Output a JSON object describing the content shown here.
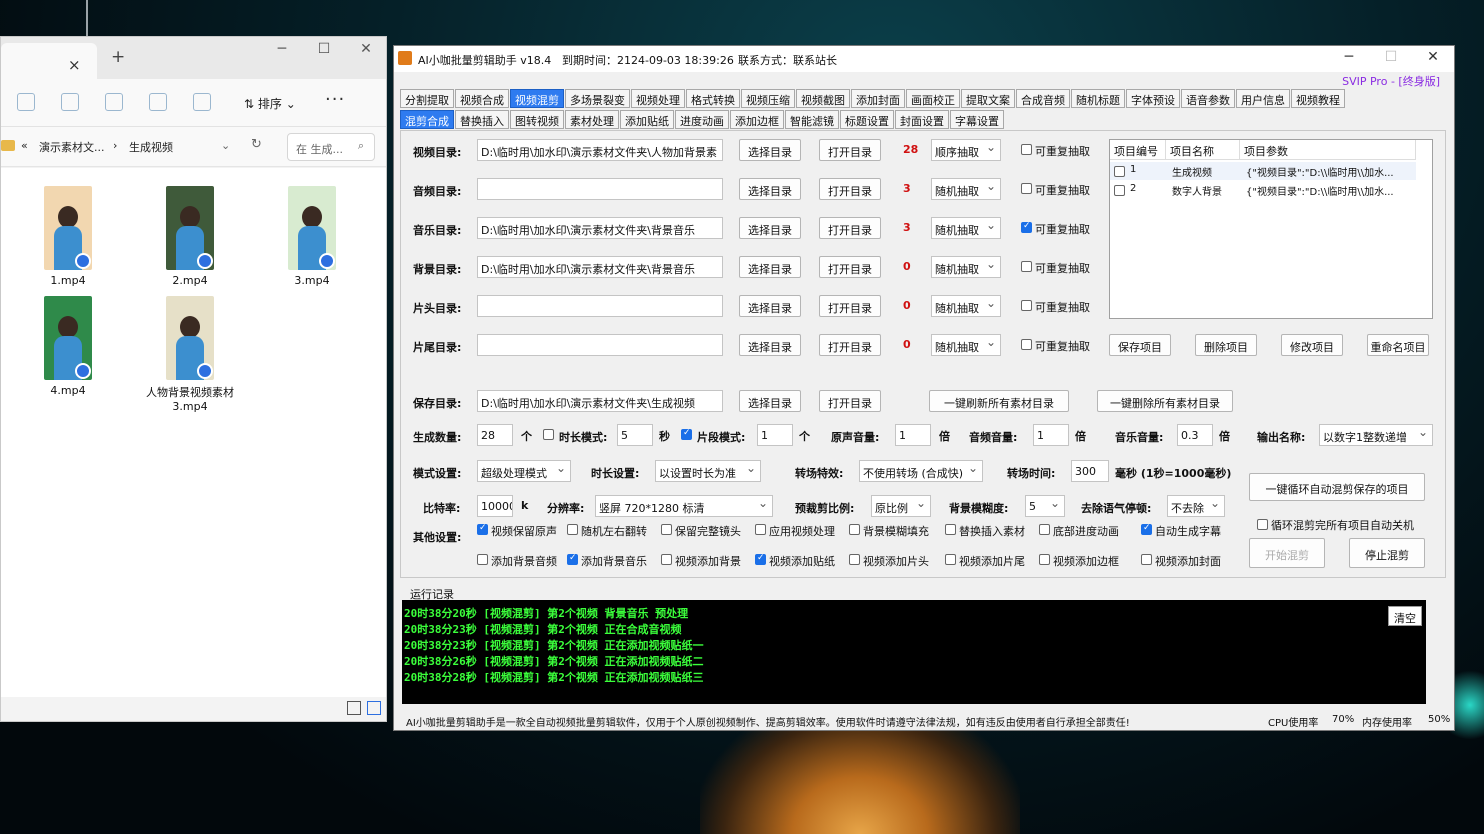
{
  "explorer": {
    "tab_close": "×",
    "new_tab": "+",
    "sort_label": "排序",
    "more": "···",
    "breadcrumb": [
      "演示素材文...",
      "生成视频"
    ],
    "search_placeholder": "在 生成...",
    "files": [
      {
        "name": "1.mp4",
        "bg": "#f2d7b0"
      },
      {
        "name": "2.mp4",
        "bg": "#3f5a3a"
      },
      {
        "name": "3.mp4",
        "bg": "#d8ebd0"
      },
      {
        "name": "4.mp4",
        "bg": "#2f8a4a"
      },
      {
        "name": "人物背景视频素材3.mp4",
        "bg": "#e6e0c8"
      }
    ]
  },
  "app": {
    "title": "AI小咖批量剪辑助手 v18.4",
    "expiry": "到期时间：2124-09-03 18:39:26",
    "contact": "联系方式：联系站长",
    "svip": "SVIP Pro - [终身版]",
    "tabs_row1": [
      "分割提取",
      "视频合成",
      "视频混剪",
      "多场景裂变",
      "视频处理",
      "格式转换",
      "视频压缩",
      "视频截图",
      "添加封面",
      "画面校正",
      "提取文案",
      "合成音频",
      "随机标题",
      "字体预设",
      "语音参数",
      "用户信息",
      "视频教程"
    ],
    "tabs_row2": [
      "混剪合成",
      "替换插入",
      "图转视频",
      "素材处理",
      "添加贴纸",
      "进度动画",
      "添加边框",
      "智能滤镜",
      "标题设置",
      "封面设置",
      "字幕设置"
    ],
    "dirs": [
      {
        "label": "视频目录:",
        "path": "D:\\临时用\\加水印\\演示素材文件夹\\人物加背景素",
        "count": "28",
        "mode": "顺序抽取",
        "repeat": false
      },
      {
        "label": "音频目录:",
        "path": "",
        "count": "3",
        "mode": "随机抽取",
        "repeat": false
      },
      {
        "label": "音乐目录:",
        "path": "D:\\临时用\\加水印\\演示素材文件夹\\背景音乐",
        "count": "3",
        "mode": "随机抽取",
        "repeat": true
      },
      {
        "label": "背景目录:",
        "path": "D:\\临时用\\加水印\\演示素材文件夹\\背景音乐",
        "count": "0",
        "mode": "随机抽取",
        "repeat": false
      },
      {
        "label": "片头目录:",
        "path": "",
        "count": "0",
        "mode": "随机抽取",
        "repeat": false
      },
      {
        "label": "片尾目录:",
        "path": "",
        "count": "0",
        "mode": "随机抽取",
        "repeat": false
      }
    ],
    "choose_dir": "选择目录",
    "open_dir": "打开目录",
    "repeat_label": "可重复抽取",
    "save_dir_label": "保存目录:",
    "save_dir_path": "D:\\临时用\\加水印\\演示素材文件夹\\生成视频",
    "refresh_all": "一键刷新所有素材目录",
    "delete_all": "一键删除所有素材目录",
    "project_table": {
      "headers": [
        "项目编号",
        "项目名称",
        "项目参数"
      ],
      "rows": [
        {
          "id": "1",
          "name": "生成视频",
          "params": "{\"视频目录\":\"D:\\\\临时用\\\\加水..."
        },
        {
          "id": "2",
          "name": "数字人背景",
          "params": "{\"视频目录\":\"D:\\\\临时用\\\\加水..."
        }
      ]
    },
    "project_buttons": [
      "保存项目",
      "删除项目",
      "修改项目",
      "重命名项目"
    ],
    "row_gen": {
      "count_label": "生成数量:",
      "count": "28",
      "unit_ge": "个",
      "duration_mode": "时长模式:",
      "duration_val": "5",
      "unit_sec": "秒",
      "clip_mode": "片段模式:",
      "clip_val": "1",
      "unit_ge2": "个",
      "orig_vol": "原声音量:",
      "orig_vol_val": "1",
      "unit_bei": "倍",
      "audio_vol": "音频音量:",
      "audio_vol_val": "1",
      "unit_bei2": "倍",
      "music_vol": "音乐音量:",
      "music_vol_val": "0.3",
      "unit_bei3": "倍",
      "output_name": "输出名称:",
      "output_name_val": "以数字1整数递增"
    },
    "row_mode": {
      "mode_label": "模式设置:",
      "mode_val": "超级处理模式",
      "dur_label": "时长设置:",
      "dur_val": "以设置时长为准",
      "trans_label": "转场特效:",
      "trans_val": "不使用转场 (合成快)",
      "trans_time_label": "转场时间:",
      "trans_time_val": "300",
      "trans_time_unit": "毫秒 (1秒=1000毫秒)"
    },
    "row_bitrate": {
      "bitrate_label": "比特率:",
      "bitrate_val": "10000",
      "bitrate_unit": "k",
      "res_label": "分辨率:",
      "res_val": "竖屏  720*1280    标清",
      "crop_label": "预裁剪比例:",
      "crop_val": "原比例",
      "blur_label": "背景模糊度:",
      "blur_val": "5",
      "filler_label": "去除语气停顿:",
      "filler_val": "不去除"
    },
    "loop_save_btn": "一键循环自动混剪保存的项目",
    "loop_shutdown": "循环混剪完所有项目自动关机",
    "other_label": "其他设置:",
    "options": [
      {
        "label": "视频保留原声",
        "on": true
      },
      {
        "label": "随机左右翻转",
        "on": false
      },
      {
        "label": "保留完整镜头",
        "on": false
      },
      {
        "label": "应用视频处理",
        "on": false
      },
      {
        "label": "背景模糊填充",
        "on": false
      },
      {
        "label": "替换插入素材",
        "on": false
      },
      {
        "label": "底部进度动画",
        "on": false
      },
      {
        "label": "自动生成字幕",
        "on": true
      },
      {
        "label": "添加背景音频",
        "on": false
      },
      {
        "label": "添加背景音乐",
        "on": true
      },
      {
        "label": "视频添加背景",
        "on": false
      },
      {
        "label": "视频添加贴纸",
        "on": true
      },
      {
        "label": "视频添加片头",
        "on": false
      },
      {
        "label": "视频添加片尾",
        "on": false
      },
      {
        "label": "视频添加边框",
        "on": false
      },
      {
        "label": "视频添加封面",
        "on": false
      }
    ],
    "start_btn": "开始混剪",
    "stop_btn": "停止混剪",
    "log_label": "运行记录",
    "clear_btn": "清空",
    "log_lines": [
      "20时38分20秒 [视频混剪] 第2个视频 背景音乐 预处理",
      "20时38分23秒 [视频混剪] 第2个视频 正在合成音视频",
      "20时38分23秒 [视频混剪] 第2个视频 正在添加视频贴纸一",
      "20时38分26秒 [视频混剪] 第2个视频 正在添加视频贴纸二",
      "20时38分28秒 [视频混剪] 第2个视频 正在添加视频贴纸三"
    ],
    "status_text": "AI小咖批量剪辑助手是一款全自动视频批量剪辑软件，仅用于个人原创视频制作、提高剪辑效率。使用软件时请遵守法律法规，如有违反由使用者自行承担全部责任!",
    "cpu_label": "CPU使用率",
    "cpu_val": "70%",
    "mem_label": "内存使用率",
    "mem_val": "50%"
  }
}
